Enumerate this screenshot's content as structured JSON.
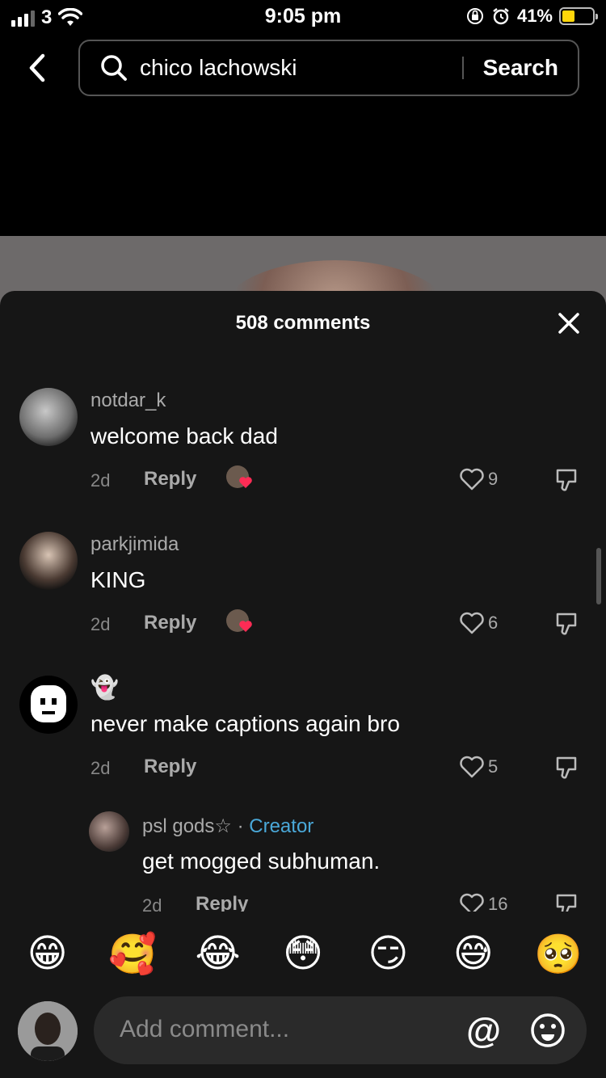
{
  "status": {
    "carrier": "3",
    "time": "9:05 pm",
    "battery": "41%"
  },
  "search": {
    "query": "chico lachowski",
    "button": "Search"
  },
  "sheet": {
    "title": "508 comments"
  },
  "comments": [
    {
      "user": "notdar_k",
      "text": "welcome back dad",
      "age": "2d",
      "reply": "Reply",
      "likes": "9",
      "creator_liked": true
    },
    {
      "user": "parkjimida",
      "text": "KING",
      "age": "2d",
      "reply": "Reply",
      "likes": "6",
      "creator_liked": true
    },
    {
      "user": "👻",
      "text": "never make captions again bro",
      "age": "2d",
      "reply": "Reply",
      "likes": "5",
      "creator_liked": false
    },
    {
      "user": "psl gods☆",
      "sep": "·",
      "badge": "Creator",
      "text": "get mogged subhuman.",
      "age": "2d",
      "reply": "Reply",
      "likes": "16"
    }
  ],
  "emoji_bar": [
    "😁",
    "🥰",
    "😂",
    "😳",
    "😏",
    "😅",
    "🥺"
  ],
  "input": {
    "placeholder": "Add comment...",
    "mention": "@"
  },
  "colors": {
    "sheet_bg": "#161616",
    "creator_badge": "#4aa8d8",
    "battery": "#ffd60a",
    "heart": "#fe2c55"
  }
}
